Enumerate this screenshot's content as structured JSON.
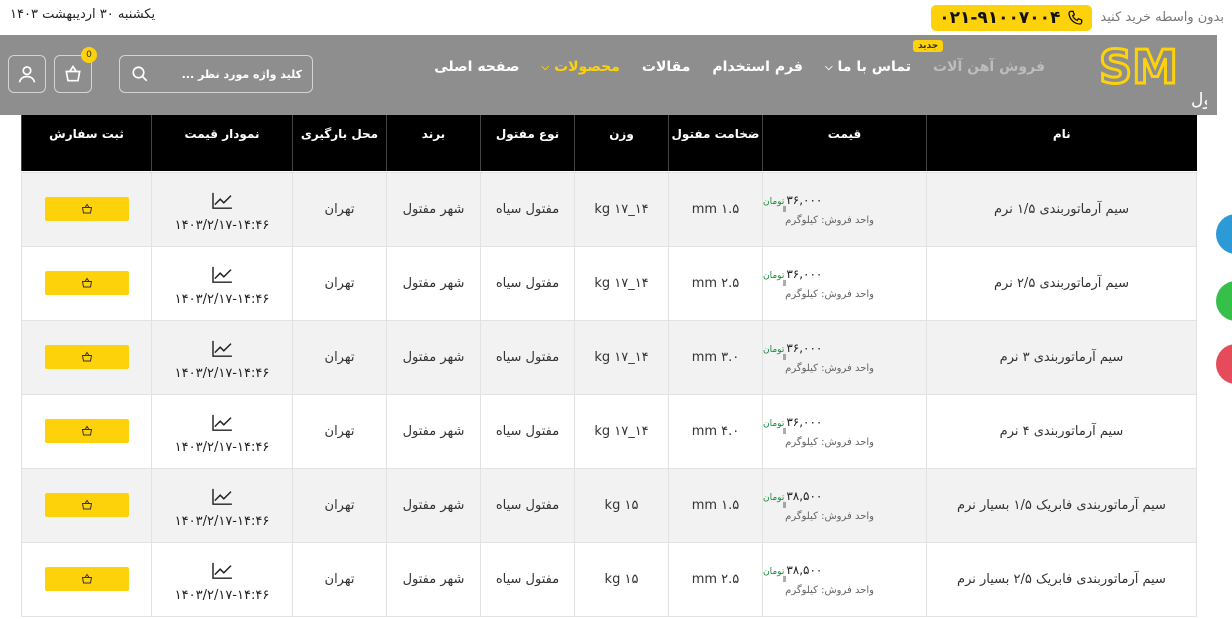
{
  "topbar": {
    "date": "یکشنبه ۳۰ اردیبهشت ۱۴۰۳",
    "label": "بدون واسطه خرید کنید",
    "phone": "۰۲۱-۹۱۰۰۷۰۰۴"
  },
  "logo": {
    "mark": "SM",
    "caption": "شهر مفتول"
  },
  "nav": {
    "items": [
      {
        "label": "صفحه اصلی"
      },
      {
        "label": "محصولات"
      },
      {
        "label": "مقالات"
      },
      {
        "label": "فرم استخدام"
      },
      {
        "label": "تماس با ما"
      },
      {
        "label": "فروش آهن آلات"
      }
    ],
    "new_badge": "جدید"
  },
  "search": {
    "placeholder": "کلید واژه مورد نظر ..."
  },
  "cart": {
    "count": "0"
  },
  "table": {
    "headers": [
      "نام",
      "قیمت",
      "ضخامت مفتول",
      "وزن",
      "نوع مفتول",
      "برند",
      "محل بارگیری",
      "نمودار قیمت",
      "ثبت سفارش"
    ],
    "currency": "تومان",
    "unit_label": "واحد فروش: کیلوگرم",
    "rows": [
      {
        "name": "سیم آرماتوربندی ۱/۵ نرم",
        "price": "۳۶,۰۰۰",
        "thickness": "۱.۵ mm",
        "weight": "۱۴_۱۷ kg",
        "type": "مفتول سیاه",
        "brand": "شهر مفتول",
        "location": "تهران",
        "chart_date": "۱۴۰۳/۲/۱۷-۱۴:۴۶"
      },
      {
        "name": "سیم آرماتوربندی ۲/۵ نرم",
        "price": "۳۶,۰۰۰",
        "thickness": "۲.۵ mm",
        "weight": "۱۴_۱۷ kg",
        "type": "مفتول سیاه",
        "brand": "شهر مفتول",
        "location": "تهران",
        "chart_date": "۱۴۰۳/۲/۱۷-۱۴:۴۶"
      },
      {
        "name": "سیم آرماتوربندی ۳ نرم",
        "price": "۳۶,۰۰۰",
        "thickness": "۳.۰ mm",
        "weight": "۱۴_۱۷ kg",
        "type": "مفتول سیاه",
        "brand": "شهر مفتول",
        "location": "تهران",
        "chart_date": "۱۴۰۳/۲/۱۷-۱۴:۴۶"
      },
      {
        "name": "سیم آرماتوربندی ۴ نرم",
        "price": "۳۶,۰۰۰",
        "thickness": "۴.۰ mm",
        "weight": "۱۴_۱۷ kg",
        "type": "مفتول سیاه",
        "brand": "شهر مفتول",
        "location": "تهران",
        "chart_date": "۱۴۰۳/۲/۱۷-۱۴:۴۶"
      },
      {
        "name": "سیم آرماتوربندی فابریک ۱/۵ بسیار نرم",
        "price": "۳۸,۵۰۰",
        "thickness": "۱.۵ mm",
        "weight": "۱۵ kg",
        "type": "مفتول سیاه",
        "brand": "شهر مفتول",
        "location": "تهران",
        "chart_date": "۱۴۰۳/۲/۱۷-۱۴:۴۶"
      },
      {
        "name": "سیم آرماتوربندی فابریک ۲/۵ بسیار نرم",
        "price": "۳۸,۵۰۰",
        "thickness": "۲.۵ mm",
        "weight": "۱۵ kg",
        "type": "مفتول سیاه",
        "brand": "شهر مفتول",
        "location": "تهران",
        "chart_date": "۱۴۰۳/۲/۱۷-۱۴:۴۶"
      }
    ]
  },
  "colors": {
    "accent": "#fdd20b",
    "header_bg": "#8e8e8e",
    "table_head": "#000000",
    "currency": "#1a8a3a"
  }
}
